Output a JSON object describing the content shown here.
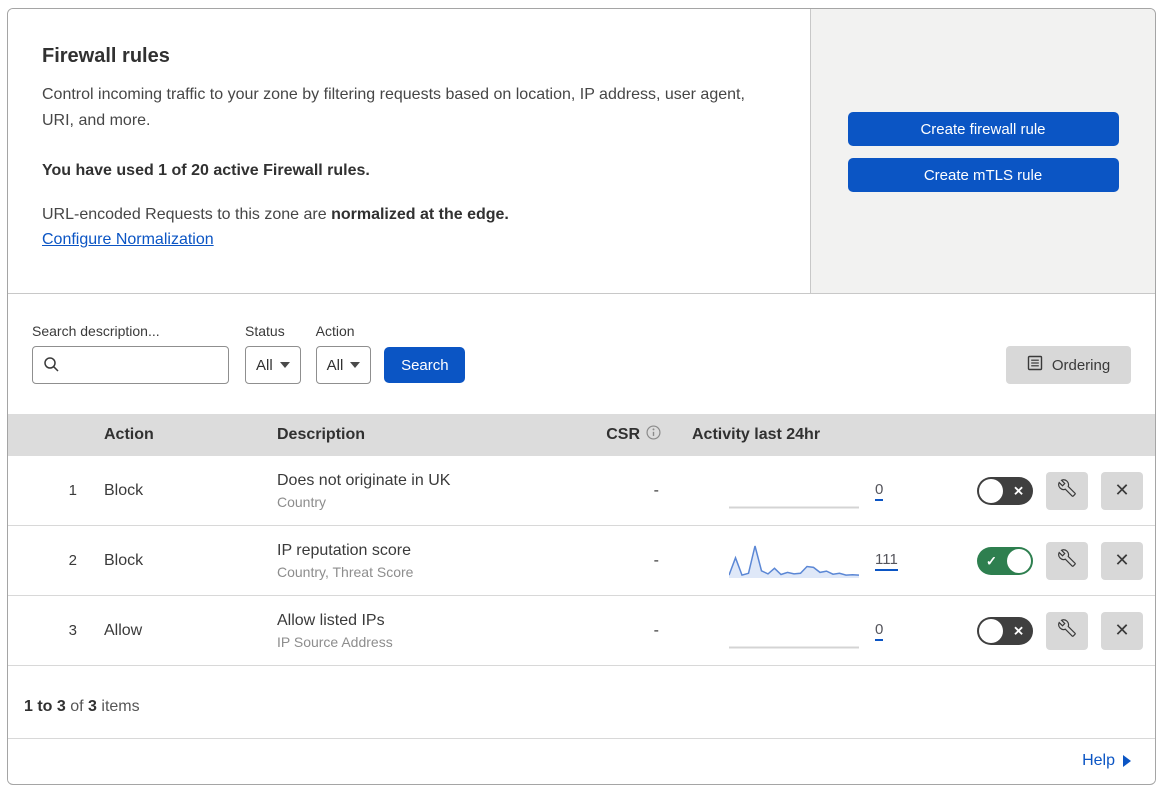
{
  "header": {
    "title": "Firewall rules",
    "description": "Control incoming traffic to your zone by filtering requests based on location, IP address, user agent, URI, and more.",
    "usage": "You have used 1 of 20 active Firewall rules.",
    "normalization_text": "URL-encoded Requests to this zone are ",
    "normalization_bold": "normalized at the edge.",
    "normalization_link": "Configure Normalization",
    "create_firewall_button": "Create firewall rule",
    "create_mtls_button": "Create mTLS rule"
  },
  "filters": {
    "search_label": "Search description...",
    "status_label": "Status",
    "status_value": "All",
    "action_label": "Action",
    "action_value": "All",
    "search_button": "Search",
    "ordering_button": "Ordering"
  },
  "table": {
    "columns": {
      "action": "Action",
      "description": "Description",
      "csr": "CSR",
      "activity": "Activity last 24hr"
    },
    "rows": [
      {
        "index": "1",
        "action": "Block",
        "description": "Does not originate in UK",
        "fields": "Country",
        "csr": "-",
        "activity_count": "0",
        "enabled": false,
        "sparkline": []
      },
      {
        "index": "2",
        "action": "Block",
        "description": "IP reputation score",
        "fields": "Country, Threat Score",
        "csr": "-",
        "activity_count": "111",
        "enabled": true,
        "sparkline": [
          0.06,
          0.62,
          0.06,
          0.12,
          1.0,
          0.2,
          0.1,
          0.28,
          0.08,
          0.15,
          0.1,
          0.12,
          0.34,
          0.31,
          0.15,
          0.19,
          0.09,
          0.12,
          0.06,
          0.07,
          0.06
        ]
      },
      {
        "index": "3",
        "action": "Allow",
        "description": "Allow listed IPs",
        "fields": "IP Source Address",
        "csr": "-",
        "activity_count": "0",
        "enabled": false,
        "sparkline": []
      }
    ]
  },
  "footer": {
    "range": "1 to 3",
    "of": " of ",
    "total": "3",
    "items": " items",
    "help": "Help"
  },
  "icons": {
    "check": "✓",
    "cross": "✕",
    "close": "✕"
  },
  "colors": {
    "accent_blue": "#0b55c4",
    "toggle_on_green": "#2e7f4f",
    "toggle_off_gray": "#3f3f3f",
    "sparkline_line": "#5b87d5",
    "sparkline_fill": "#dfe8f8",
    "sparkline_flat": "#d4d4d4",
    "header_band": "#dcdcdc",
    "panel_gray": "#f2f2f1"
  }
}
